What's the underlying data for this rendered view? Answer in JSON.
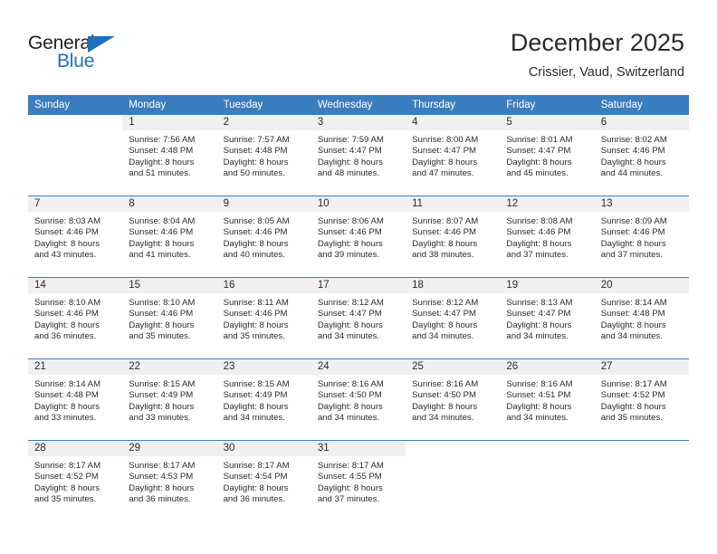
{
  "brand": {
    "name_dark": "General",
    "name_blue": "Blue",
    "accent_color": "#1f71b8"
  },
  "header": {
    "title": "December 2025",
    "subtitle": "Crissier, Vaud, Switzerland",
    "header_bg_color": "#3b7ebf",
    "daynum_bg_color": "#f0f0f0"
  },
  "weekdays": [
    "Sunday",
    "Monday",
    "Tuesday",
    "Wednesday",
    "Thursday",
    "Friday",
    "Saturday"
  ],
  "weeks": [
    [
      {
        "day": "",
        "lines": []
      },
      {
        "day": "1",
        "lines": [
          "Sunrise: 7:56 AM",
          "Sunset: 4:48 PM",
          "Daylight: 8 hours",
          "and 51 minutes."
        ]
      },
      {
        "day": "2",
        "lines": [
          "Sunrise: 7:57 AM",
          "Sunset: 4:48 PM",
          "Daylight: 8 hours",
          "and 50 minutes."
        ]
      },
      {
        "day": "3",
        "lines": [
          "Sunrise: 7:59 AM",
          "Sunset: 4:47 PM",
          "Daylight: 8 hours",
          "and 48 minutes."
        ]
      },
      {
        "day": "4",
        "lines": [
          "Sunrise: 8:00 AM",
          "Sunset: 4:47 PM",
          "Daylight: 8 hours",
          "and 47 minutes."
        ]
      },
      {
        "day": "5",
        "lines": [
          "Sunrise: 8:01 AM",
          "Sunset: 4:47 PM",
          "Daylight: 8 hours",
          "and 45 minutes."
        ]
      },
      {
        "day": "6",
        "lines": [
          "Sunrise: 8:02 AM",
          "Sunset: 4:46 PM",
          "Daylight: 8 hours",
          "and 44 minutes."
        ]
      }
    ],
    [
      {
        "day": "7",
        "lines": [
          "Sunrise: 8:03 AM",
          "Sunset: 4:46 PM",
          "Daylight: 8 hours",
          "and 43 minutes."
        ]
      },
      {
        "day": "8",
        "lines": [
          "Sunrise: 8:04 AM",
          "Sunset: 4:46 PM",
          "Daylight: 8 hours",
          "and 41 minutes."
        ]
      },
      {
        "day": "9",
        "lines": [
          "Sunrise: 8:05 AM",
          "Sunset: 4:46 PM",
          "Daylight: 8 hours",
          "and 40 minutes."
        ]
      },
      {
        "day": "10",
        "lines": [
          "Sunrise: 8:06 AM",
          "Sunset: 4:46 PM",
          "Daylight: 8 hours",
          "and 39 minutes."
        ]
      },
      {
        "day": "11",
        "lines": [
          "Sunrise: 8:07 AM",
          "Sunset: 4:46 PM",
          "Daylight: 8 hours",
          "and 38 minutes."
        ]
      },
      {
        "day": "12",
        "lines": [
          "Sunrise: 8:08 AM",
          "Sunset: 4:46 PM",
          "Daylight: 8 hours",
          "and 37 minutes."
        ]
      },
      {
        "day": "13",
        "lines": [
          "Sunrise: 8:09 AM",
          "Sunset: 4:46 PM",
          "Daylight: 8 hours",
          "and 37 minutes."
        ]
      }
    ],
    [
      {
        "day": "14",
        "lines": [
          "Sunrise: 8:10 AM",
          "Sunset: 4:46 PM",
          "Daylight: 8 hours",
          "and 36 minutes."
        ]
      },
      {
        "day": "15",
        "lines": [
          "Sunrise: 8:10 AM",
          "Sunset: 4:46 PM",
          "Daylight: 8 hours",
          "and 35 minutes."
        ]
      },
      {
        "day": "16",
        "lines": [
          "Sunrise: 8:11 AM",
          "Sunset: 4:46 PM",
          "Daylight: 8 hours",
          "and 35 minutes."
        ]
      },
      {
        "day": "17",
        "lines": [
          "Sunrise: 8:12 AM",
          "Sunset: 4:47 PM",
          "Daylight: 8 hours",
          "and 34 minutes."
        ]
      },
      {
        "day": "18",
        "lines": [
          "Sunrise: 8:12 AM",
          "Sunset: 4:47 PM",
          "Daylight: 8 hours",
          "and 34 minutes."
        ]
      },
      {
        "day": "19",
        "lines": [
          "Sunrise: 8:13 AM",
          "Sunset: 4:47 PM",
          "Daylight: 8 hours",
          "and 34 minutes."
        ]
      },
      {
        "day": "20",
        "lines": [
          "Sunrise: 8:14 AM",
          "Sunset: 4:48 PM",
          "Daylight: 8 hours",
          "and 34 minutes."
        ]
      }
    ],
    [
      {
        "day": "21",
        "lines": [
          "Sunrise: 8:14 AM",
          "Sunset: 4:48 PM",
          "Daylight: 8 hours",
          "and 33 minutes."
        ]
      },
      {
        "day": "22",
        "lines": [
          "Sunrise: 8:15 AM",
          "Sunset: 4:49 PM",
          "Daylight: 8 hours",
          "and 33 minutes."
        ]
      },
      {
        "day": "23",
        "lines": [
          "Sunrise: 8:15 AM",
          "Sunset: 4:49 PM",
          "Daylight: 8 hours",
          "and 34 minutes."
        ]
      },
      {
        "day": "24",
        "lines": [
          "Sunrise: 8:16 AM",
          "Sunset: 4:50 PM",
          "Daylight: 8 hours",
          "and 34 minutes."
        ]
      },
      {
        "day": "25",
        "lines": [
          "Sunrise: 8:16 AM",
          "Sunset: 4:50 PM",
          "Daylight: 8 hours",
          "and 34 minutes."
        ]
      },
      {
        "day": "26",
        "lines": [
          "Sunrise: 8:16 AM",
          "Sunset: 4:51 PM",
          "Daylight: 8 hours",
          "and 34 minutes."
        ]
      },
      {
        "day": "27",
        "lines": [
          "Sunrise: 8:17 AM",
          "Sunset: 4:52 PM",
          "Daylight: 8 hours",
          "and 35 minutes."
        ]
      }
    ],
    [
      {
        "day": "28",
        "lines": [
          "Sunrise: 8:17 AM",
          "Sunset: 4:52 PM",
          "Daylight: 8 hours",
          "and 35 minutes."
        ]
      },
      {
        "day": "29",
        "lines": [
          "Sunrise: 8:17 AM",
          "Sunset: 4:53 PM",
          "Daylight: 8 hours",
          "and 36 minutes."
        ]
      },
      {
        "day": "30",
        "lines": [
          "Sunrise: 8:17 AM",
          "Sunset: 4:54 PM",
          "Daylight: 8 hours",
          "and 36 minutes."
        ]
      },
      {
        "day": "31",
        "lines": [
          "Sunrise: 8:17 AM",
          "Sunset: 4:55 PM",
          "Daylight: 8 hours",
          "and 37 minutes."
        ]
      },
      {
        "day": "",
        "lines": []
      },
      {
        "day": "",
        "lines": []
      },
      {
        "day": "",
        "lines": []
      }
    ]
  ]
}
